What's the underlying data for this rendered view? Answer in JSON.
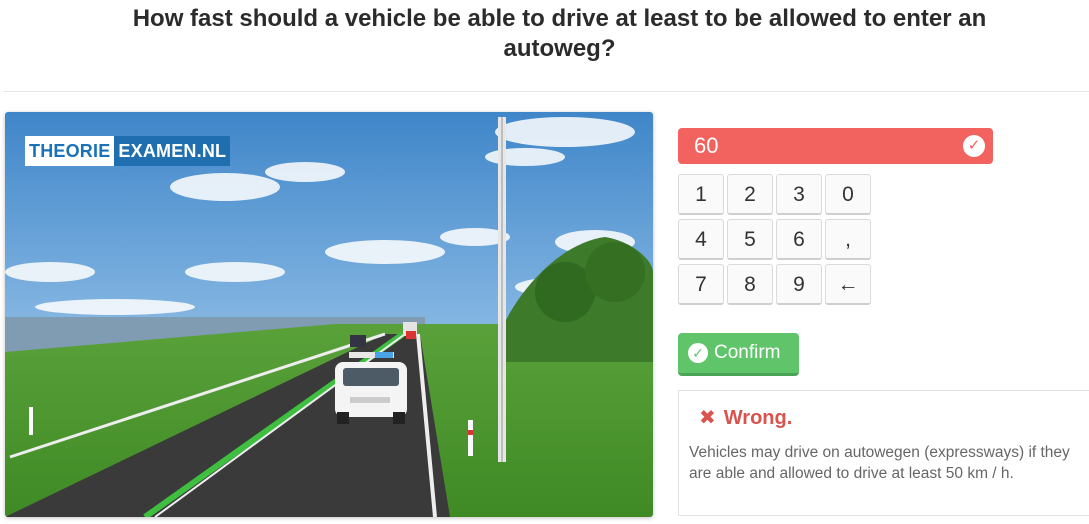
{
  "question": {
    "line1": "How fast should a vehicle be able to drive at least to be allowed to enter an",
    "line2": "autoweg?"
  },
  "image": {
    "logo_part1": "THEORIE",
    "logo_part2": "EXAMEN.NL"
  },
  "answer": {
    "value": "60",
    "icon": "check-circle-icon",
    "status_color": "#f2625e"
  },
  "keypad": {
    "keys": [
      "1",
      "2",
      "3",
      "0",
      "4",
      "5",
      "6",
      ",",
      "7",
      "8",
      "9",
      "←"
    ],
    "backspace_icon": "arrow-left-icon"
  },
  "confirm": {
    "label": "Confirm",
    "icon": "check-circle-icon",
    "color": "#5fc46a"
  },
  "feedback": {
    "icon": "x-icon",
    "title": "Wrong.",
    "text": "Vehicles may drive on autowegen (expressways) if they are able and allowed to drive at least 50 km / h.",
    "color": "#d9534f"
  }
}
